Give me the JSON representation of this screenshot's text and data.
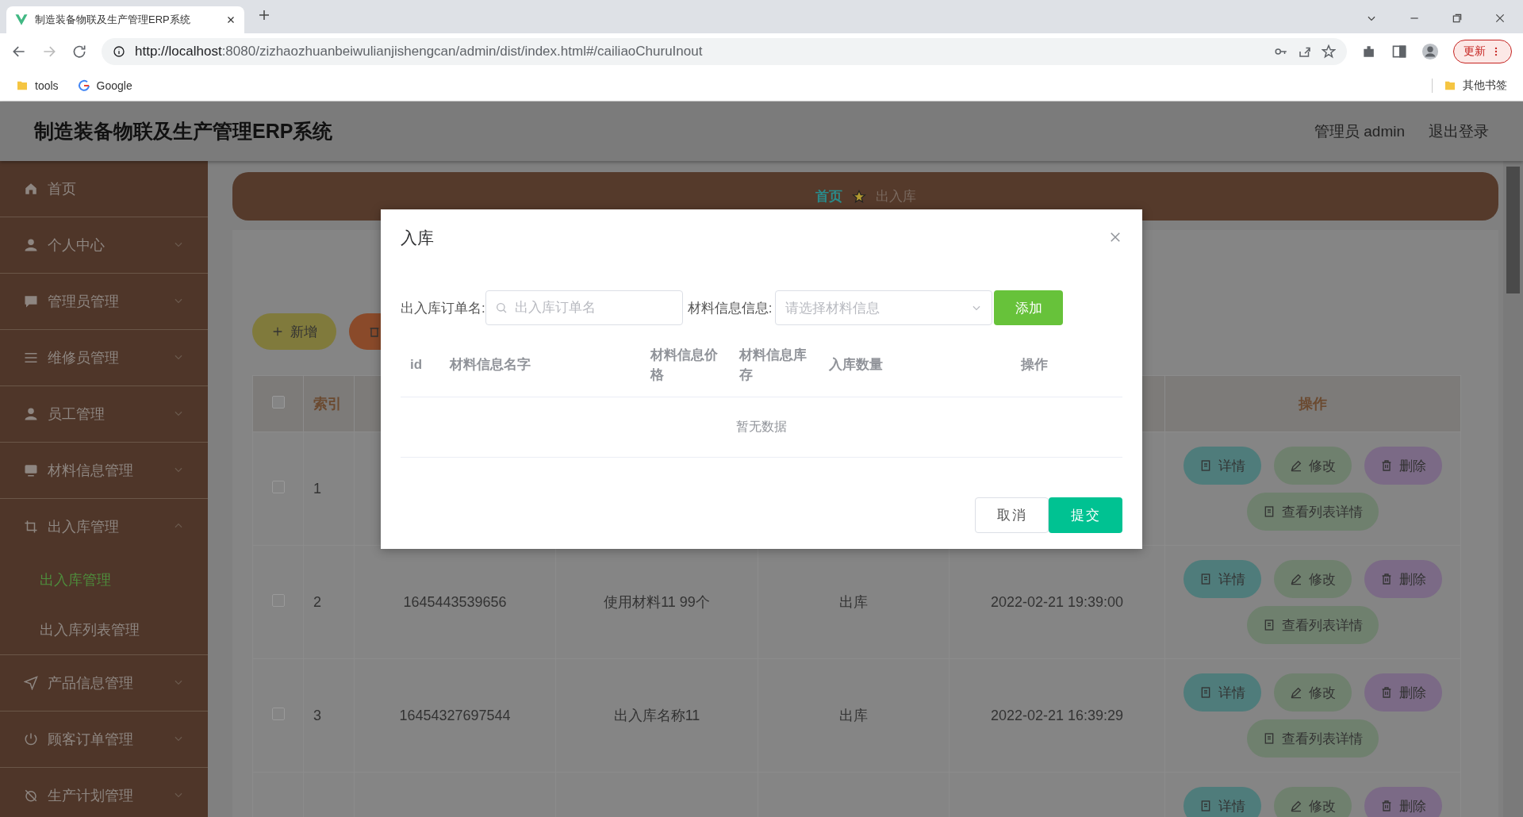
{
  "browser": {
    "tab_title": "制造装备物联及生产管理ERP系统",
    "url_host": "http://localhost",
    "url_rest": ":8080/zizhaozhuanbeiwulianjishengcan/admin/dist/index.html#/cailiaoChuruInout",
    "update_button": "更新",
    "bookmarks": [
      {
        "label": "tools",
        "kind": "folder"
      },
      {
        "label": "Google",
        "kind": "google"
      }
    ],
    "other_bookmarks": "其他书签"
  },
  "header": {
    "title": "制造装备物联及生产管理ERP系统",
    "user": "管理员 admin",
    "logout": "退出登录"
  },
  "sidebar": {
    "items": [
      {
        "label": "首页",
        "kind": "home"
      },
      {
        "label": "个人中心",
        "kind": "person",
        "expanded": false
      },
      {
        "label": "管理员管理",
        "kind": "chat",
        "expanded": false
      },
      {
        "label": "维修员管理",
        "kind": "list",
        "expanded": false
      },
      {
        "label": "员工管理",
        "kind": "person",
        "expanded": false
      },
      {
        "label": "材料信息管理",
        "kind": "monitor",
        "expanded": false
      },
      {
        "label": "出入库管理",
        "kind": "crop",
        "expanded": true,
        "children": [
          {
            "label": "出入库管理",
            "selected": true
          },
          {
            "label": "出入库列表管理",
            "selected": false
          }
        ]
      },
      {
        "label": "产品信息管理",
        "kind": "send",
        "expanded": false
      },
      {
        "label": "顾客订单管理",
        "kind": "power",
        "expanded": false
      },
      {
        "label": "生产计划管理",
        "kind": "alarm",
        "expanded": false
      }
    ]
  },
  "breadcrumb": [
    {
      "label": "首页",
      "selected": true
    },
    {
      "label": "出入库",
      "selected": false
    }
  ],
  "toolbar": [
    {
      "kind": "add",
      "label": "新增"
    },
    {
      "kind": "delete"
    }
  ],
  "table": {
    "header_checked": false,
    "header": {
      "index": "索引",
      "actions": "操作"
    },
    "rows": [
      {
        "checked": false,
        "index": "1",
        "actions": [
          {
            "kind": "detail",
            "label": "详情"
          },
          {
            "kind": "edit",
            "label": "修改"
          },
          {
            "kind": "delete",
            "label": "删除"
          },
          {
            "kind": "list",
            "label": "查看列表详情"
          }
        ]
      },
      {
        "checked": false,
        "index": "2",
        "order_no": "1645443539656",
        "name": "使用材料11 99个",
        "type": "出库",
        "time": "2022-02-21 19:39:00",
        "actions": [
          {
            "kind": "detail",
            "label": "详情"
          },
          {
            "kind": "edit",
            "label": "修改"
          },
          {
            "kind": "delete",
            "label": "删除"
          },
          {
            "kind": "list",
            "label": "查看列表详情"
          }
        ]
      },
      {
        "checked": false,
        "index": "3",
        "order_no": "16454327697544",
        "name": "出入库名称11",
        "type": "出库",
        "time": "2022-02-21 16:39:29",
        "actions": [
          {
            "kind": "detail",
            "label": "详情"
          },
          {
            "kind": "edit",
            "label": "修改"
          },
          {
            "kind": "delete",
            "label": "删除"
          },
          {
            "kind": "list",
            "label": "查看列表详情"
          }
        ]
      },
      {
        "actions": [
          {
            "kind": "detail",
            "label": "详情"
          },
          {
            "kind": "edit",
            "label": "修改"
          },
          {
            "kind": "delete",
            "label": "删除"
          }
        ]
      }
    ]
  },
  "dialog": {
    "title": "入库",
    "order_label": "出入库订单名:",
    "order_placeholder": "出入库订单名",
    "material_label": "材料信息信息:",
    "material_placeholder": "请选择材料信息",
    "add_button": "添加",
    "columns": [
      "id",
      "材料信息名字",
      "材料信息价格",
      "材料信息库存",
      "入库数量",
      "操作"
    ],
    "empty_text": "暂无数据",
    "cancel_button": "取消",
    "submit_button": "提交"
  }
}
